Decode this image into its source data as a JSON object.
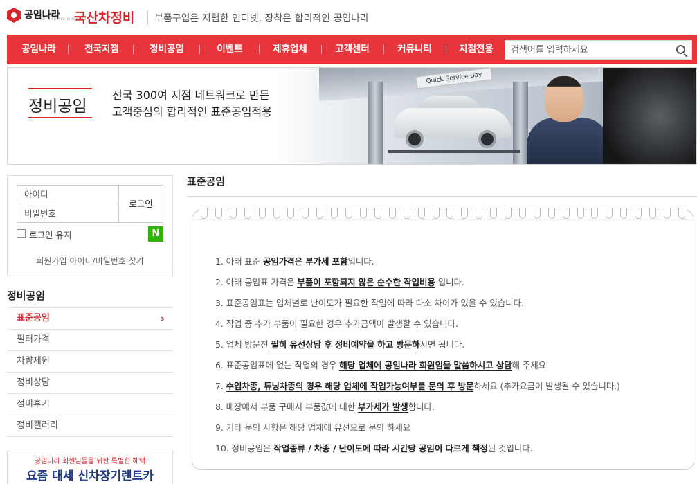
{
  "header": {
    "logo_text": "공임나라",
    "logo_sub": "AUTOMOTIVE WORKSHOP",
    "brand": "국산차정비",
    "tagline": "부품구입은 저렴한 인터넷, 장착은 합리적인 공임나라"
  },
  "nav": {
    "items": [
      "공임나라",
      "전국지점",
      "정비공임",
      "이벤트",
      "제휴업체",
      "고객센터",
      "커뮤니티",
      "지점전용"
    ],
    "search_placeholder": "검색어를 입력하세요"
  },
  "banner": {
    "title": "정비공임",
    "desc_line1": "전국 300여 지점 네트워크로 만든",
    "desc_line2": "고객중심의 합리적인 표준공임적용",
    "sign_text": "Quick Service Bay"
  },
  "login": {
    "id_placeholder": "아이디",
    "pw_placeholder": "비밀번호",
    "login_button": "로그인",
    "keep_login": "로그인 유지",
    "naver_label": "N",
    "join_find": "회원가입 아이디/비밀번호 찾기"
  },
  "sidebar": {
    "title": "정비공임",
    "items": [
      {
        "label": "표준공임",
        "active": true
      },
      {
        "label": "필터가격",
        "active": false
      },
      {
        "label": "차량제원",
        "active": false
      },
      {
        "label": "정비상담",
        "active": false
      },
      {
        "label": "정비후기",
        "active": false
      },
      {
        "label": "정비갤러리",
        "active": false
      }
    ],
    "arrow": "›"
  },
  "ad": {
    "small": "공임나라 회원님들을 위한 특별한 혜택",
    "big": "요즘 대세 신차장기렌트카"
  },
  "main": {
    "title": "표준공임",
    "notes": [
      {
        "pre": "1. 아래 표준 ",
        "bold": "공임가격은 부가세 포함",
        "post": "입니다."
      },
      {
        "pre": "2. 아래 공임표 가격은 ",
        "bold": "부품이 포함되지 않은 순수한 작업비용",
        "post": " 입니다."
      },
      {
        "pre": "3. 표준공임표는 업체별로 난이도가 필요한 작업에 따라 다소 차이가 있을 수 있습니다.",
        "bold": "",
        "post": ""
      },
      {
        "pre": "4. 작업 중 추가 부품이 필요한 경우 추가금액이 발생할 수 있습니다.",
        "bold": "",
        "post": ""
      },
      {
        "pre": "5. 업체 방문전 ",
        "bold": "필히 유선상담 후 정비예약을 하고 방문하",
        "post": "시면 됩니다."
      },
      {
        "pre": "6. 표준공임표에 없는 작업의 경우 ",
        "bold": "해당 업체에 공임나라 회원임을 말씀하시고 상담",
        "post": "해 주세요"
      },
      {
        "pre": "7. ",
        "bold": "수입차종, 튜닝차종의 경우 해당 업체에 작업가능여부를 문의 후 방문",
        "post": "하세요 (추가요금이 발생될 수 있습니다.)"
      },
      {
        "pre": "8. 매장에서 부품 구매시 부품값에 대한 ",
        "bold": "부가세가 발생",
        "post": "합니다."
      },
      {
        "pre": "9. 기타 문의 사항은 해당 업체에 유선으로 문의 하세요",
        "bold": "",
        "post": ""
      },
      {
        "pre": "10. 정비공임은 ",
        "bold": "작업종류 / 차종 / 난이도에 따라 시간당 공임이 다르게 책정",
        "post": "된 것입니다."
      }
    ]
  },
  "colors": {
    "accent": "#e8353c",
    "brand_red": "#d8232a",
    "naver_green": "#2db400"
  }
}
